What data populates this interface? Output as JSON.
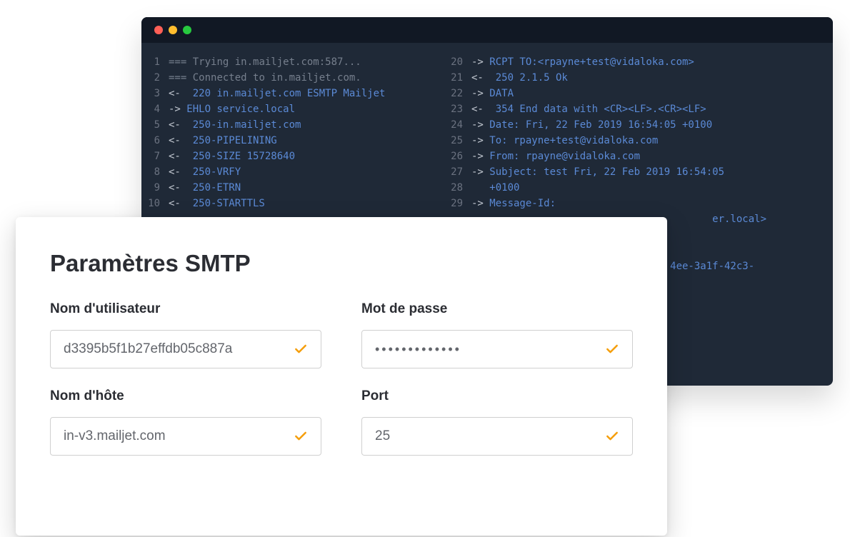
{
  "terminal": {
    "left": {
      "linenos": [
        "1",
        "2",
        "3",
        "4",
        "5",
        "6",
        "7",
        "8",
        "9",
        "10"
      ],
      "lines": [
        {
          "prefix": "===",
          "pcolor": "c-gray",
          "text": " Trying in.mailjet.com:587...",
          "tcolor": "c-gray"
        },
        {
          "prefix": "===",
          "pcolor": "c-gray",
          "text": " Connected to in.mailjet.com.",
          "tcolor": "c-gray"
        },
        {
          "prefix": "<-",
          "pcolor": "c-light",
          "text": "  220 in.mailjet.com ESMTP Mailjet",
          "tcolor": "c-blue"
        },
        {
          "prefix": "->",
          "pcolor": "c-light",
          "text": " EHLO service.local",
          "tcolor": "c-blue"
        },
        {
          "prefix": "<-",
          "pcolor": "c-light",
          "text": "  250-in.mailjet.com",
          "tcolor": "c-blue"
        },
        {
          "prefix": "<-",
          "pcolor": "c-light",
          "text": "  250-PIPELINING",
          "tcolor": "c-blue"
        },
        {
          "prefix": "<-",
          "pcolor": "c-light",
          "text": "  250-SIZE 15728640",
          "tcolor": "c-blue"
        },
        {
          "prefix": "<-",
          "pcolor": "c-light",
          "text": "  250-VRFY",
          "tcolor": "c-blue"
        },
        {
          "prefix": "<-",
          "pcolor": "c-light",
          "text": "  250-ETRN",
          "tcolor": "c-blue"
        },
        {
          "prefix": "<-",
          "pcolor": "c-light",
          "text": "  250-STARTTLS",
          "tcolor": "c-blue"
        }
      ]
    },
    "right": {
      "linenos": [
        "20",
        "21",
        "22",
        "23",
        "24",
        "25",
        "26",
        "27",
        "28",
        "29",
        "",
        "",
        "",
        "",
        ""
      ],
      "lines": [
        {
          "prefix": "->",
          "pcolor": "c-light",
          "text": " RCPT TO:<rpayne+test@vidaloka.com>",
          "tcolor": "c-blue"
        },
        {
          "prefix": "<-",
          "pcolor": "c-light",
          "text": "  250 2.1.5 Ok",
          "tcolor": "c-blue"
        },
        {
          "prefix": "->",
          "pcolor": "c-light",
          "text": " DATA",
          "tcolor": "c-blue"
        },
        {
          "prefix": "<-",
          "pcolor": "c-light",
          "text": "  354 End data with <CR><LF>.<CR><LF>",
          "tcolor": "c-blue"
        },
        {
          "prefix": "->",
          "pcolor": "c-light",
          "text": " Date: Fri, 22 Feb 2019 16:54:05 +0100",
          "tcolor": "c-blue"
        },
        {
          "prefix": "->",
          "pcolor": "c-light",
          "text": " To: rpayne+test@vidaloka.com",
          "tcolor": "c-blue"
        },
        {
          "prefix": "->",
          "pcolor": "c-light",
          "text": " From: rpayne@vidaloka.com",
          "tcolor": "c-blue"
        },
        {
          "prefix": "->",
          "pcolor": "c-light",
          "text": " Subject: test Fri, 22 Feb 2019 16:54:05",
          "tcolor": "c-blue"
        },
        {
          "prefix": "",
          "pcolor": "",
          "text": "   +0100",
          "tcolor": "c-blue"
        },
        {
          "prefix": "->",
          "pcolor": "c-light",
          "text": " Message-Id:",
          "tcolor": "c-blue"
        },
        {
          "prefix": "",
          "pcolor": "",
          "text": "                                        er.local>",
          "tcolor": "c-blue"
        },
        {
          "prefix": "",
          "pcolor": "",
          "text": "",
          "tcolor": ""
        },
        {
          "prefix": "",
          "pcolor": "",
          "text": "",
          "tcolor": ""
        },
        {
          "prefix": "",
          "pcolor": "",
          "text": "                                 4ee-3a1f-42c3-",
          "tcolor": "c-blue"
        },
        {
          "prefix": "",
          "pcolor": "",
          "text": "",
          "tcolor": ""
        }
      ]
    }
  },
  "settings": {
    "title": "Paramètres SMTP",
    "fields": {
      "username_label": "Nom d'utilisateur",
      "username_value": "d3395b5f1b27effdb05c887a",
      "password_label": "Mot de passe",
      "password_value": "•••••••••••••",
      "host_label": "Nom d'hôte",
      "host_value": "in-v3.mailjet.com",
      "port_label": "Port",
      "port_value": "25"
    }
  }
}
